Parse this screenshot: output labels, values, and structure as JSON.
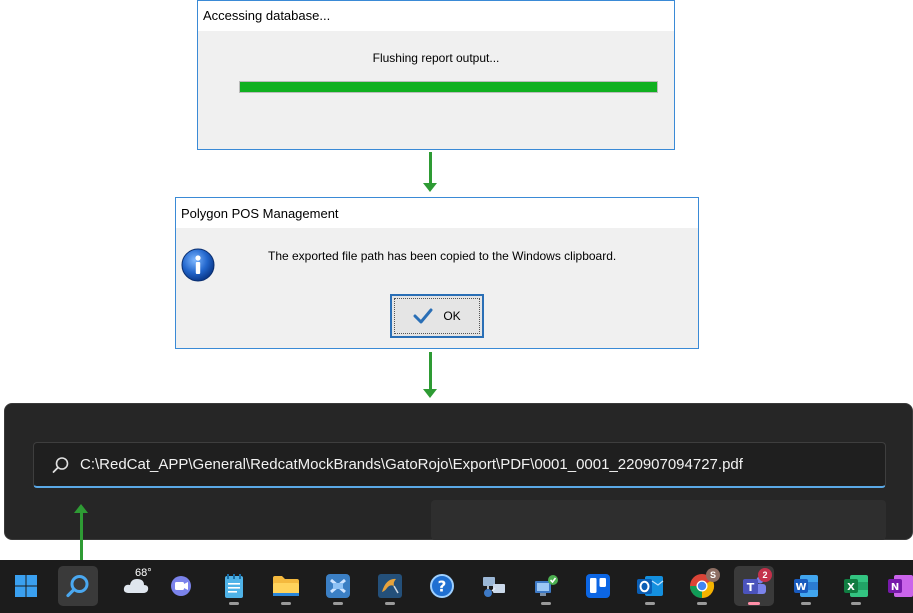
{
  "progress_dialog": {
    "title": "Accessing database...",
    "message": "Flushing report output...",
    "progress_fraction": 1.0,
    "progress_color": "#10b020"
  },
  "message_box": {
    "title": "Polygon POS Management",
    "icon": "information-icon",
    "message": "The exported file path has been copied to the Windows clipboard.",
    "ok_label": "OK"
  },
  "search": {
    "value": "C:\\RedCat_APP\\General\\RedcatMockBrands\\GatoRojo\\Export\\PDF\\0001_0001_220907094727.pdf",
    "icon": "search-icon",
    "accent_color": "#5aa8e6"
  },
  "arrow_color": "#2e9b34",
  "taskbar": {
    "weather_temp": "68°",
    "items": [
      {
        "name": "start-button",
        "icon": "windows-logo-icon"
      },
      {
        "name": "search-taskbar-button",
        "icon": "search-icon",
        "active": true
      },
      {
        "name": "weather-widget",
        "icon": "cloud-icon"
      },
      {
        "name": "teams-chat-button",
        "icon": "video-chat-icon"
      },
      {
        "name": "notepad-button",
        "icon": "notepad-icon"
      },
      {
        "name": "file-explorer-button",
        "icon": "folder-icon"
      },
      {
        "name": "app-button-1",
        "icon": "pos-app-icon"
      },
      {
        "name": "mysql-button",
        "icon": "dolphin-icon"
      },
      {
        "name": "help-button",
        "icon": "help-icon"
      },
      {
        "name": "remote-app-button",
        "icon": "network-icon"
      },
      {
        "name": "remote-desktop-button",
        "icon": "remote-desktop-icon"
      },
      {
        "name": "trello-button",
        "icon": "trello-icon"
      },
      {
        "name": "outlook-button",
        "icon": "outlook-icon"
      },
      {
        "name": "chrome-button",
        "icon": "chrome-icon"
      },
      {
        "name": "teams-button",
        "icon": "teams-icon"
      },
      {
        "name": "word-button",
        "icon": "word-icon"
      },
      {
        "name": "excel-button",
        "icon": "excel-icon"
      },
      {
        "name": "onenote-button",
        "icon": "onenote-icon"
      }
    ],
    "chrome_badge": "S",
    "teams_badge": "2"
  }
}
